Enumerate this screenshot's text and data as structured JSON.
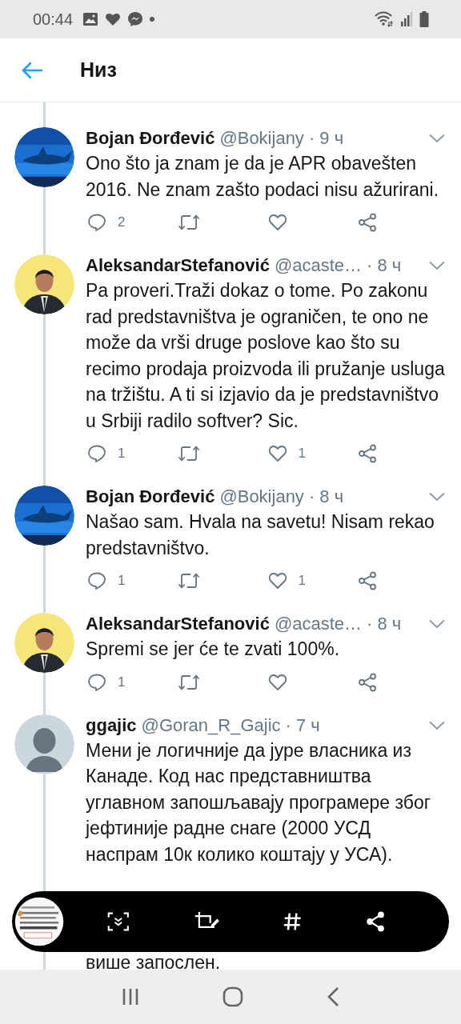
{
  "status_bar": {
    "time": "00:44"
  },
  "header": {
    "title": "Низ"
  },
  "tweets": [
    {
      "name": "Bojan Đorđević",
      "handle": "@Bokijany",
      "time": "· 9 ч",
      "text": "Ono što ja znam je da je APR obavešten 2016. Ne znam zašto podaci nisu ažurirani.",
      "actions": {
        "replies": "2"
      }
    },
    {
      "name": "AleksandarStefanović",
      "handle": "@acaste…",
      "time": "· 8 ч",
      "text": "Pa proveri.Traži dokaz o tome. Po zakonu rad predstavništva je ograničen, te ono ne može da vrši druge poslove kao što su recimo prodaja proizvoda ili pružanje usluga na tržištu. A ti si izjavio da je predstavništvo u Srbiji radilo softver? Sic.",
      "actions": {
        "replies": "1",
        "likes": "1"
      }
    },
    {
      "name": "Bojan Đorđević",
      "handle": "@Bokijany",
      "time": "· 8 ч",
      "text": "Našao sam. Hvala na savetu! Nisam rekao predstavništvo.",
      "actions": {
        "replies": "1",
        "likes": "1"
      }
    },
    {
      "name": "AleksandarStefanović",
      "handle": "@acaste…",
      "time": "· 8 ч",
      "text": "Spremi se jer će te zvati 100%.",
      "actions": {
        "replies": "1"
      }
    },
    {
      "name": "ggajic",
      "handle": "@Goran_R_Gajic",
      "time": "· 7 ч",
      "text": "Мени је логичније да јуре власника из Канаде. Код нас представништва углавном запошљавају програмере због јефтиније радне снаге (2000 УСД наспрам 10к колико коштају у УСА).",
      "text_fragment": "више запослен."
    }
  ]
}
